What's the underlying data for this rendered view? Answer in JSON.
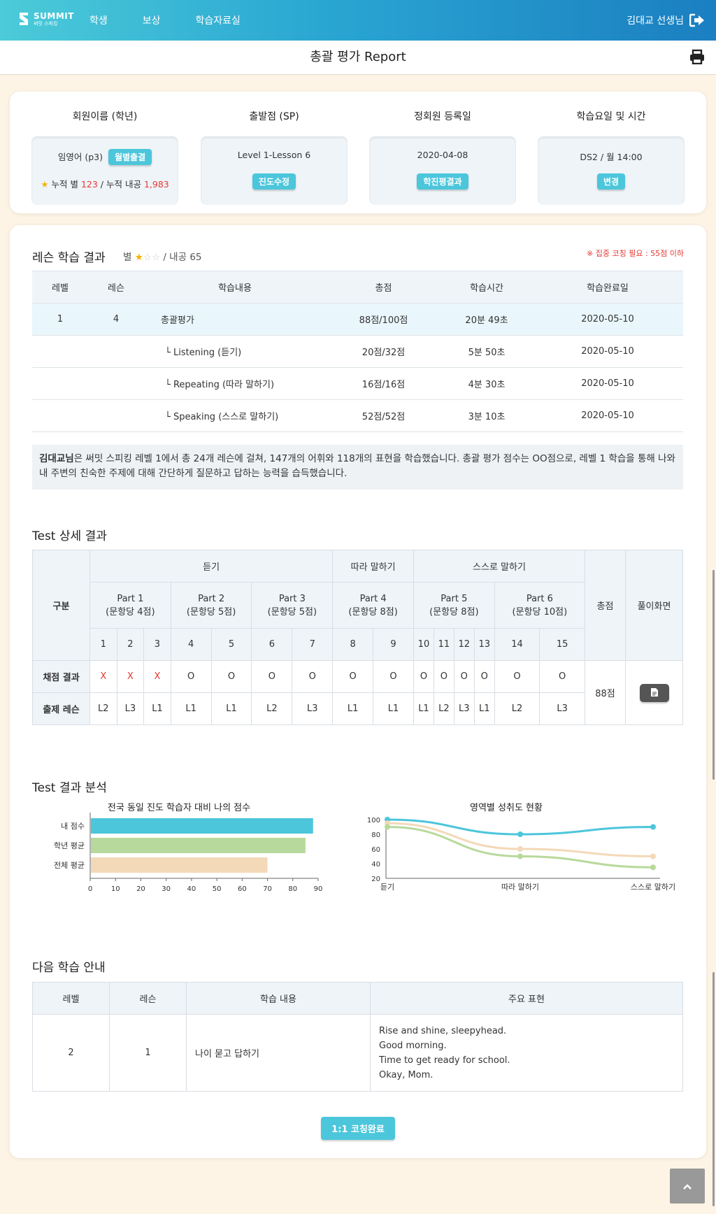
{
  "header": {
    "logo_main": "SUMMIT",
    "logo_sub": "써밋 스피킹",
    "nav": [
      "학생",
      "보상",
      "학습자료실"
    ],
    "user": "김대교 선생님"
  },
  "title": "총괄 평가 Report",
  "info": [
    {
      "head": "회원이름 (학년)",
      "line1": "임영어 (p3)",
      "pill": "월별출결",
      "stars_label": "누적 별",
      "stars_value": "123",
      "coins_label": "누적 내공",
      "coins_value": "1,983"
    },
    {
      "head": "출발점 (SP)",
      "line1": "Level 1-Lesson 6",
      "pill": "진도수정"
    },
    {
      "head": "정회원 등록일",
      "line1": "2020-04-08",
      "pill": "학진평결과"
    },
    {
      "head": "학습요일 및 시간",
      "line1": "DS2 / 월 14:00",
      "pill": "변경"
    }
  ],
  "lesson": {
    "title": "레슨 학습 결과",
    "star_label": "별",
    "rating": 1,
    "rating_max": 3,
    "power": "/ 내공 65",
    "notice": "※ 집중 코칭 필요 : 55점 이하",
    "columns": [
      "레벨",
      "레슨",
      "학습내용",
      "총점",
      "학습시간",
      "학습완료일"
    ],
    "rows": [
      {
        "level": "1",
        "lesson": "4",
        "content": "총괄평가",
        "score": "88점/100점",
        "time": "20분 49초",
        "date": "2020-05-10"
      },
      {
        "level": "",
        "lesson": "",
        "content": "└ Listening (듣기)",
        "score": "20점/32점",
        "time": "5분 50초",
        "date": "2020-05-10"
      },
      {
        "level": "",
        "lesson": "",
        "content": "└ Repeating (따라 말하기)",
        "score": "16점/16점",
        "time": "4분 30초",
        "date": "2020-05-10"
      },
      {
        "level": "",
        "lesson": "",
        "content": "└ Speaking (스스로 말하기)",
        "score": "52점/52점",
        "time": "3분 10초",
        "date": "2020-05-10"
      }
    ],
    "summary_name": "김대교님",
    "summary_text": "은 써밋 스피킹 레벨 1에서 총 24개 레슨에 걸쳐, 147개의 어휘와 118개의 표현을 학습했습니다. 총괄 평가 점수는 OO점으로, 레벨 1 학습을 통해 나와 내 주변의 친숙한 주제에 대해 간단하게 질문하고 답하는 능력을 습득했습니다."
  },
  "test": {
    "title": "Test 상세 결과",
    "col_label": "구분",
    "groups": [
      {
        "name": "듣기",
        "span": 3
      },
      {
        "name": "따라 말하기",
        "span": 1
      },
      {
        "name": "스스로 말하기",
        "span": 2
      }
    ],
    "parts": [
      {
        "name": "Part 1",
        "sub": "(문항당 4점)",
        "span": 3
      },
      {
        "name": "Part 2",
        "sub": "(문항당 5점)",
        "span": 1
      },
      {
        "name": "Part 3",
        "sub": "(문항당 5점)",
        "span": 2
      },
      {
        "name": "Part 4",
        "sub": "(문항당 8점)",
        "span": 2
      },
      {
        "name": "Part 5",
        "sub": "(문항당 8점)",
        "span": 4
      },
      {
        "name": "Part 6",
        "sub": "(문항당 10점)",
        "span": 2
      }
    ],
    "numbers": [
      "1",
      "2",
      "3",
      "4",
      "5",
      "6",
      "7",
      "8",
      "9",
      "10",
      "11",
      "12",
      "13",
      "14",
      "15"
    ],
    "result_label": "채점 결과",
    "results": [
      "X",
      "X",
      "X",
      "O",
      "O",
      "O",
      "O",
      "O",
      "O",
      "O",
      "O",
      "O",
      "O",
      "O",
      "O"
    ],
    "lesson_label": "출제 레슨",
    "lessons": [
      "L2",
      "L3",
      "L1",
      "L1",
      "L1",
      "L2",
      "L3",
      "L1",
      "L1",
      "L1",
      "L2",
      "L3",
      "L1",
      "L2",
      "L3"
    ],
    "total_label": "총점",
    "total": "88점",
    "view_label": "풀이화면"
  },
  "analysis": {
    "title": "Test 결과 분석"
  },
  "chart_data": [
    {
      "type": "bar",
      "orientation": "horizontal",
      "title": "전국 동일 진도 학습자 대비 나의 점수",
      "categories": [
        "내 점수",
        "학년 평균",
        "전체 평균"
      ],
      "values": [
        88,
        85,
        70
      ],
      "colors": [
        "#4cc6db",
        "#b8d99c",
        "#f3d9b8"
      ],
      "xlim": [
        0,
        90
      ],
      "xticks": [
        0,
        10,
        20,
        30,
        40,
        50,
        60,
        70,
        80,
        90
      ]
    },
    {
      "type": "line",
      "title": "영역별 성취도 현황",
      "categories": [
        "듣기",
        "따라 말하기",
        "스스로 말하기"
      ],
      "ylim": [
        20,
        100
      ],
      "yticks": [
        20,
        40,
        60,
        80,
        100
      ],
      "series": [
        {
          "values": [
            100,
            80,
            90
          ],
          "color": "#4cc6db"
        },
        {
          "values": [
            95,
            60,
            50
          ],
          "color": "#f3d9b8"
        },
        {
          "values": [
            90,
            50,
            35
          ],
          "color": "#b8d99c"
        }
      ]
    }
  ],
  "next": {
    "title": "다음 학습 안내",
    "columns": [
      "레벨",
      "레슨",
      "학습 내용",
      "주요 표현"
    ],
    "level": "2",
    "lesson": "1",
    "content": "나이 묻고 답하기",
    "expressions": [
      "Rise and shine, sleepyhead.",
      "Good morning.",
      "Time to get ready for school.",
      "Okay, Mom."
    ]
  },
  "complete_label": "1:1 코칭완료"
}
